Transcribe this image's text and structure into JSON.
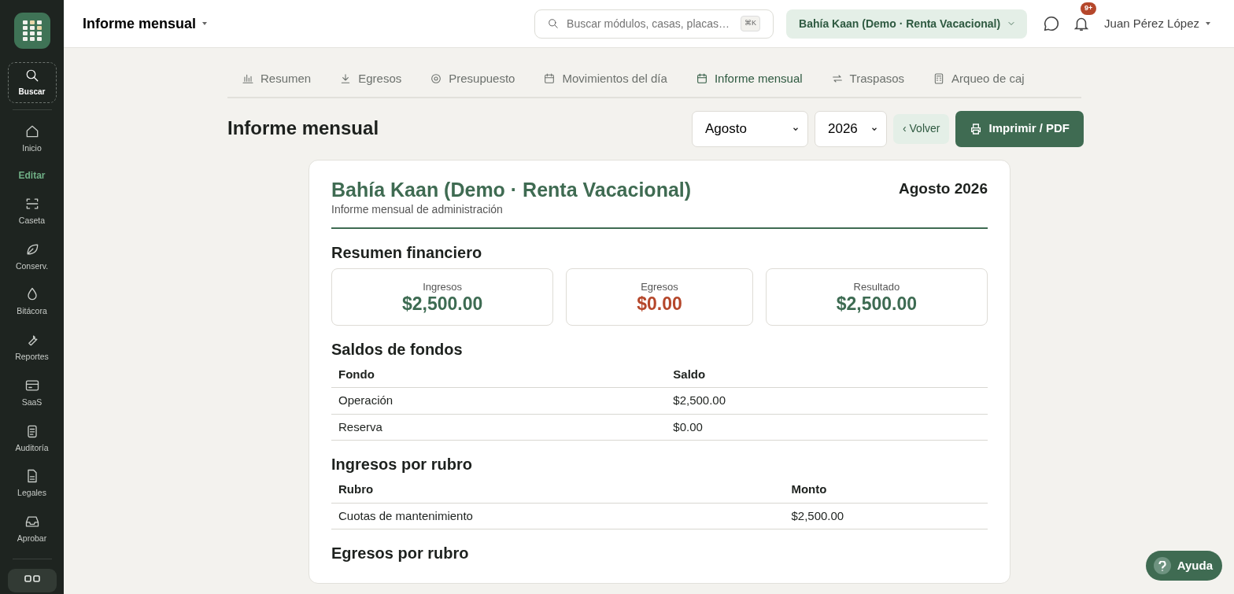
{
  "sidebar": {
    "search": {
      "label": "Buscar"
    },
    "items": [
      {
        "kind": "item",
        "label": "Inicio"
      },
      {
        "kind": "section",
        "label": "Editar"
      },
      {
        "kind": "item",
        "label": "Caseta"
      },
      {
        "kind": "item",
        "label": "Conserv."
      },
      {
        "kind": "item",
        "label": "Bitácora"
      },
      {
        "kind": "item",
        "label": "Reportes"
      },
      {
        "kind": "item",
        "label": "SaaS"
      },
      {
        "kind": "item",
        "label": "Auditoría"
      },
      {
        "kind": "item",
        "label": "Legales"
      },
      {
        "kind": "item",
        "label": "Aprobar"
      }
    ]
  },
  "topbar": {
    "title": "Informe mensual",
    "search": {
      "placeholder": "Buscar módulos, casas, placas…",
      "shortcut": "⌘K"
    },
    "property": "Bahía Kaan (Demo · Renta Vacacional)",
    "notifications": "9+",
    "user": "Juan Pérez López"
  },
  "tabs": [
    {
      "label": "Resumen",
      "selected": false
    },
    {
      "label": "Egresos",
      "selected": false
    },
    {
      "label": "Presupuesto",
      "selected": false
    },
    {
      "label": "Movimientos del día",
      "selected": false
    },
    {
      "label": "Informe mensual",
      "selected": true
    },
    {
      "label": "Traspasos",
      "selected": false
    },
    {
      "label": "Arqueo de caj",
      "selected": false
    }
  ],
  "page": {
    "title": "Informe mensual",
    "month": "Agosto",
    "year": "2026",
    "back": "‹ Volver",
    "print": "Imprimir / PDF"
  },
  "report": {
    "title": "Bahía Kaan (Demo · Renta Vacacional)",
    "subtitle": "Informe mensual de administración",
    "period": "Agosto 2026",
    "summary_title": "Resumen financiero",
    "summary": [
      {
        "label": "Ingresos",
        "value": "$2,500.00",
        "color": "#3d6b52"
      },
      {
        "label": "Egresos",
        "value": "$0.00",
        "color": "#b5472b"
      },
      {
        "label": "Resultado",
        "value": "$2,500.00",
        "color": "#3d6b52"
      }
    ],
    "tables": [
      {
        "title": "Saldos de fondos",
        "columns": [
          "Fondo",
          "Saldo"
        ],
        "rows": [
          [
            "Operación",
            "$2,500.00"
          ],
          [
            "Reserva",
            "$0.00"
          ]
        ]
      },
      {
        "title": "Ingresos por rubro",
        "columns": [
          "Rubro",
          "Monto"
        ],
        "rows": [
          [
            "Cuotas de mantenimiento",
            "$2,500.00"
          ]
        ]
      }
    ],
    "next_section": "Egresos por rubro"
  },
  "help": "Ayuda"
}
